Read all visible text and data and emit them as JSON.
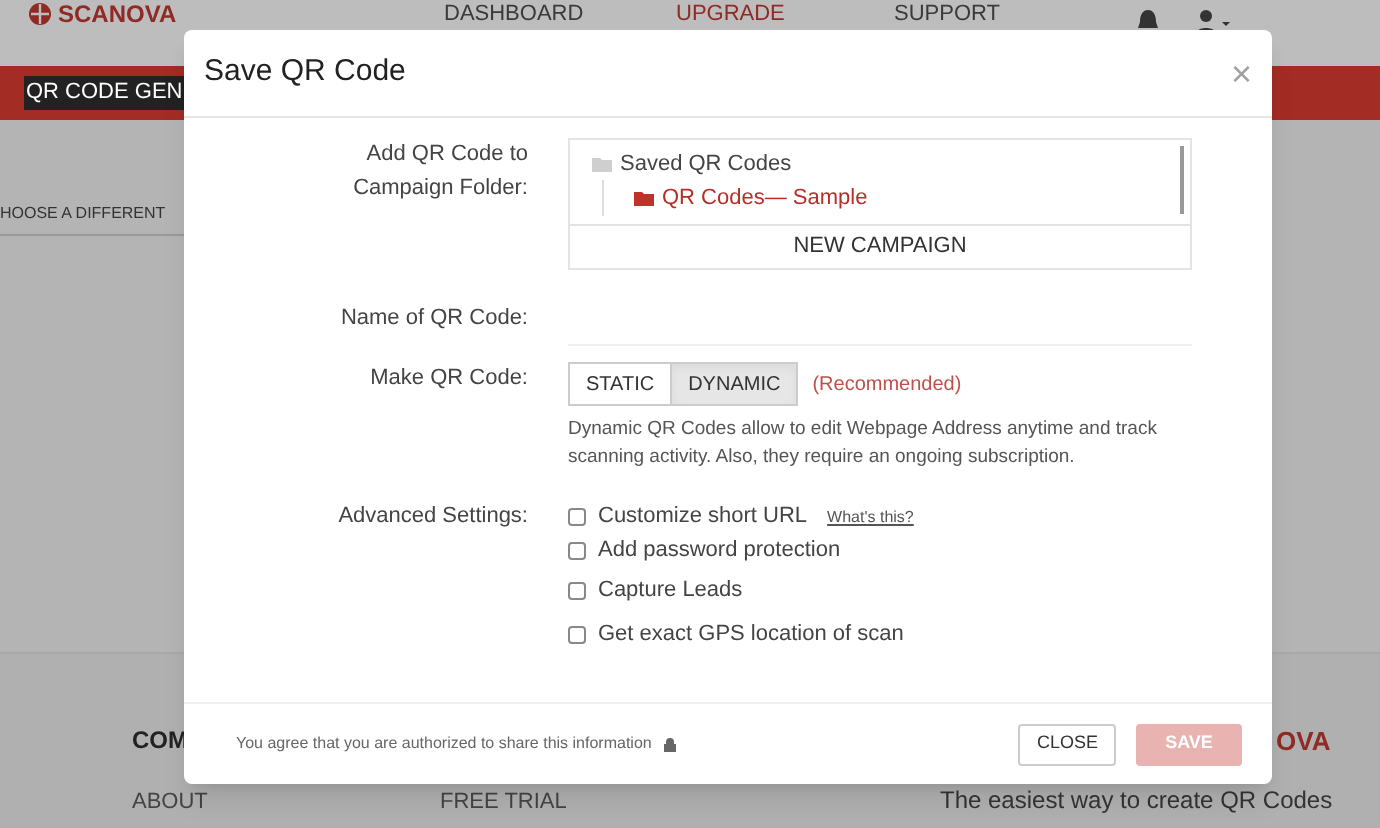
{
  "page": {
    "logo": "SCANOVA",
    "nav": [
      {
        "label": "DASHBOARD",
        "highlighted": false
      },
      {
        "label": "UPGRADE",
        "highlighted": true
      },
      {
        "label": "SUPPORT",
        "highlighted": false
      }
    ],
    "banner": "QR CODE GEN",
    "choose": "HOOSE A DIFFERENT",
    "footer": {
      "heading": "COM",
      "links": [
        "ABOUT",
        "FREE TRIAL"
      ],
      "brand": "OVA",
      "tagline": "The easiest way to create QR Codes"
    }
  },
  "modal": {
    "title": "Save QR Code",
    "close": "×",
    "folder_label": "Add QR Code to Campaign Folder:",
    "tree": {
      "label": "Saved QR Codes",
      "children": [
        {
          "label": "QR Codes— Sample",
          "selected": true
        }
      ]
    },
    "new_campaign": "NEW CAMPAIGN",
    "name_label": "Name of QR Code:",
    "type_label": "Make QR Code:",
    "types": [
      {
        "label": "STATIC",
        "selected": false
      },
      {
        "label": "DYNAMIC",
        "selected": true
      }
    ],
    "recommended": "(Recommended)",
    "description": "Dynamic QR Codes allow to edit Webpage Address anytime and track scanning activity. Also, they require an ongoing subscription.",
    "advanced_label": "Advanced Settings:",
    "settings": [
      {
        "label": "Customize short URL",
        "checked": false,
        "link": "What's this?"
      },
      {
        "label": "Add password protection",
        "checked": false
      },
      {
        "label": "Capture Leads",
        "checked": false
      },
      {
        "label": "Get exact GPS location of scan",
        "checked": false
      }
    ],
    "note": "You agree that you are authorized to share this information",
    "buttons": [
      {
        "label": "CLOSE",
        "kind": "secondary",
        "disabled": false
      },
      {
        "label": "SAVE",
        "kind": "primary",
        "disabled": true
      }
    ]
  }
}
